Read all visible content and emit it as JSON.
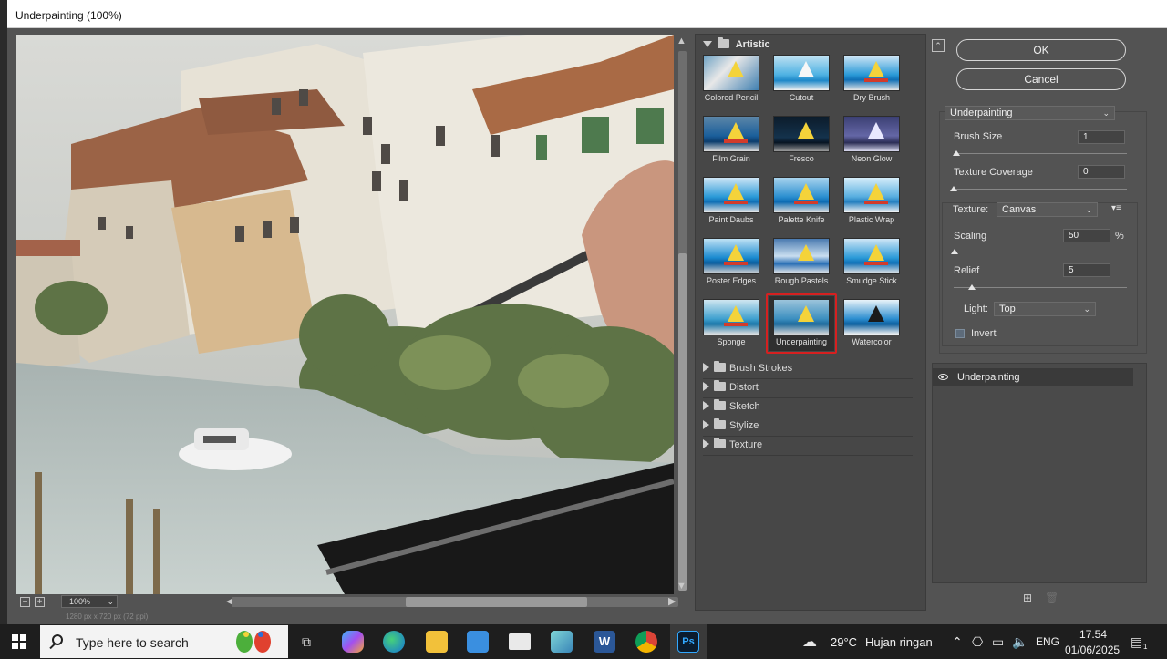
{
  "window": {
    "title": "Underpainting (100%)"
  },
  "preview": {
    "zoom": "100%",
    "dimensions": "1280 px x 720 px (72 ppi)"
  },
  "gallery": {
    "open_category": "Artistic",
    "filters": [
      "Colored Pencil",
      "Cutout",
      "Dry Brush",
      "Film Grain",
      "Fresco",
      "Neon Glow",
      "Paint Daubs",
      "Palette Knife",
      "Plastic Wrap",
      "Poster Edges",
      "Rough Pastels",
      "Smudge Stick",
      "Sponge",
      "Underpainting",
      "Watercolor"
    ],
    "selected_filter": "Underpainting",
    "collapsed_categories": [
      "Brush Strokes",
      "Distort",
      "Sketch",
      "Stylize",
      "Texture"
    ]
  },
  "buttons": {
    "ok": "OK",
    "cancel": "Cancel"
  },
  "settings": {
    "filter_select": "Underpainting",
    "brush_size_label": "Brush Size",
    "brush_size": "1",
    "texture_coverage_label": "Texture Coverage",
    "texture_coverage": "0",
    "texture_label": "Texture:",
    "texture": "Canvas",
    "scaling_label": "Scaling",
    "scaling": "50",
    "scaling_unit": "%",
    "relief_label": "Relief",
    "relief": "5",
    "light_label": "Light:",
    "light": "Top",
    "invert_label": "Invert",
    "invert_checked": false
  },
  "layers": {
    "items": [
      "Underpainting"
    ]
  },
  "taskbar": {
    "search_placeholder": "Type here to search",
    "weather_temp": "29°C",
    "weather_text": "Hujan ringan",
    "language": "ENG",
    "time": "17.54",
    "date": "01/06/2025",
    "notification_count": "1",
    "accent": "#1e1e1e"
  }
}
